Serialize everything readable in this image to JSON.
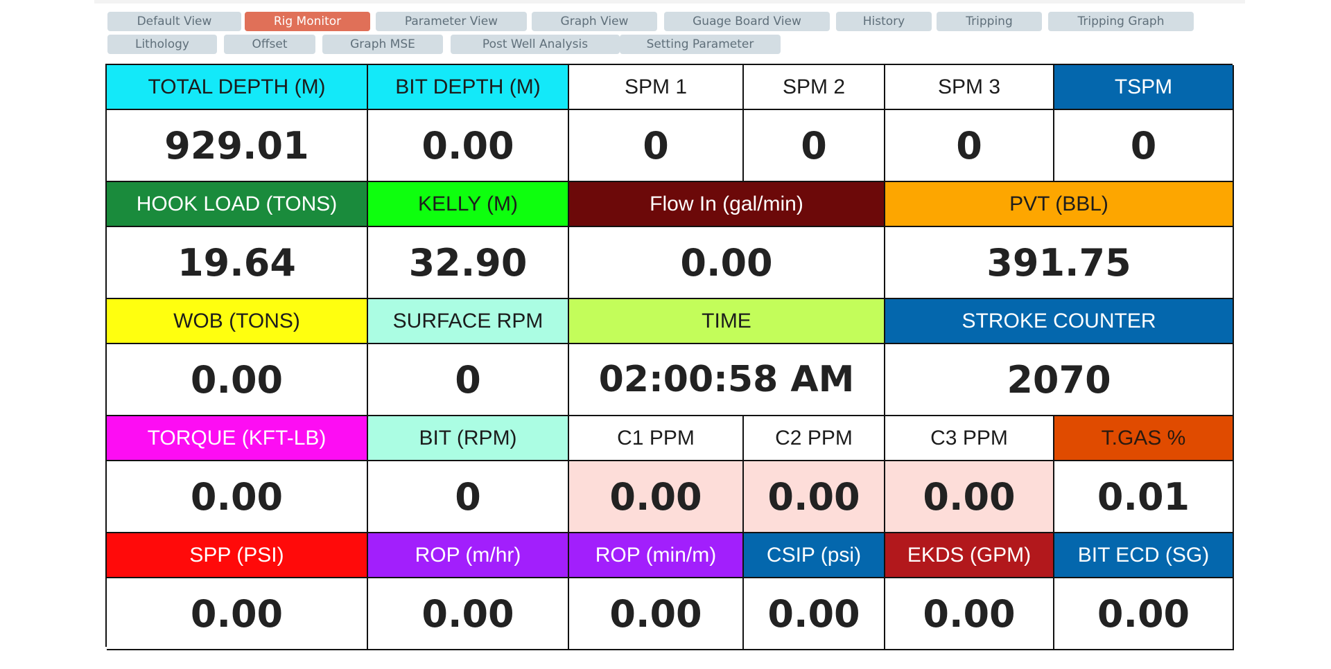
{
  "tabs": [
    {
      "label": "Default View"
    },
    {
      "label": "Rig Monitor",
      "active": true
    },
    {
      "label": "Parameter View"
    },
    {
      "label": "Graph View"
    },
    {
      "label": "Guage Board View"
    },
    {
      "label": "History"
    },
    {
      "label": "Tripping"
    },
    {
      "label": "Tripping Graph"
    },
    {
      "label": "Lithology"
    },
    {
      "label": "Offset"
    },
    {
      "label": "Graph MSE"
    },
    {
      "label": "Post Well Analysis"
    },
    {
      "label": "Setting Parameter"
    }
  ],
  "colors": {
    "tab_bg": "#d3dde3",
    "tab_active_bg": "#e07058",
    "cyan": "#13e9f9",
    "dark_blue": "#0467ad",
    "green": "#1a8b3c",
    "lime": "#0eff0e",
    "maroon": "#6c0909",
    "orange": "#fda600",
    "yellow": "#ffff0f",
    "mint": "#abfde3",
    "light_lime": "#c3fd5a",
    "magenta": "#fd0df3",
    "burnt_orange": "#e04b00",
    "red": "#ff0a0a",
    "purple": "#a21ffc",
    "crimson": "#b2181c",
    "gas_value_bg": "#fdddd9"
  },
  "panels": {
    "total_depth": {
      "label": "TOTAL DEPTH (M)",
      "value": "929.01"
    },
    "bit_depth": {
      "label": "BIT DEPTH (M)",
      "value": "0.00"
    },
    "spm1": {
      "label": "SPM 1",
      "value": "0"
    },
    "spm2": {
      "label": "SPM 2",
      "value": "0"
    },
    "spm3": {
      "label": "SPM 3",
      "value": "0"
    },
    "tspm": {
      "label": "TSPM",
      "value": "0"
    },
    "hook_load": {
      "label": "HOOK LOAD (TONS)",
      "value": "19.64"
    },
    "kelly": {
      "label": "KELLY (M)",
      "value": "32.90"
    },
    "flow_in": {
      "label": "Flow In (gal/min)",
      "value": "0.00"
    },
    "pvt": {
      "label": "PVT (BBL)",
      "value": "391.75"
    },
    "wob": {
      "label": "WOB (TONS)",
      "value": "0.00"
    },
    "surface_rpm": {
      "label": "SURFACE RPM",
      "value": "0"
    },
    "time": {
      "label": "TIME",
      "value": "02:00:58 AM"
    },
    "stroke_counter": {
      "label": "STROKE COUNTER",
      "value": "2070"
    },
    "torque": {
      "label": "TORQUE (KFT-LB)",
      "value": "0.00"
    },
    "bit_rpm": {
      "label": "BIT (RPM)",
      "value": "0"
    },
    "c1_ppm": {
      "label": "C1 PPM",
      "value": "0.00"
    },
    "c2_ppm": {
      "label": "C2 PPM",
      "value": "0.00"
    },
    "c3_ppm": {
      "label": "C3 PPM",
      "value": "0.00"
    },
    "tgas": {
      "label": "T.GAS %",
      "value": "0.01"
    },
    "spp": {
      "label": "SPP (PSI)",
      "value": "0.00"
    },
    "rop_mhr": {
      "label": "ROP (m/hr)",
      "value": "0.00"
    },
    "rop_minm": {
      "label": "ROP (min/m)",
      "value": "0.00"
    },
    "csip": {
      "label": "CSIP (psi)",
      "value": "0.00"
    },
    "ekds": {
      "label": "EKDS (GPM)",
      "value": "0.00"
    },
    "bit_ecd": {
      "label": "BIT ECD (SG)",
      "value": "0.00"
    }
  }
}
